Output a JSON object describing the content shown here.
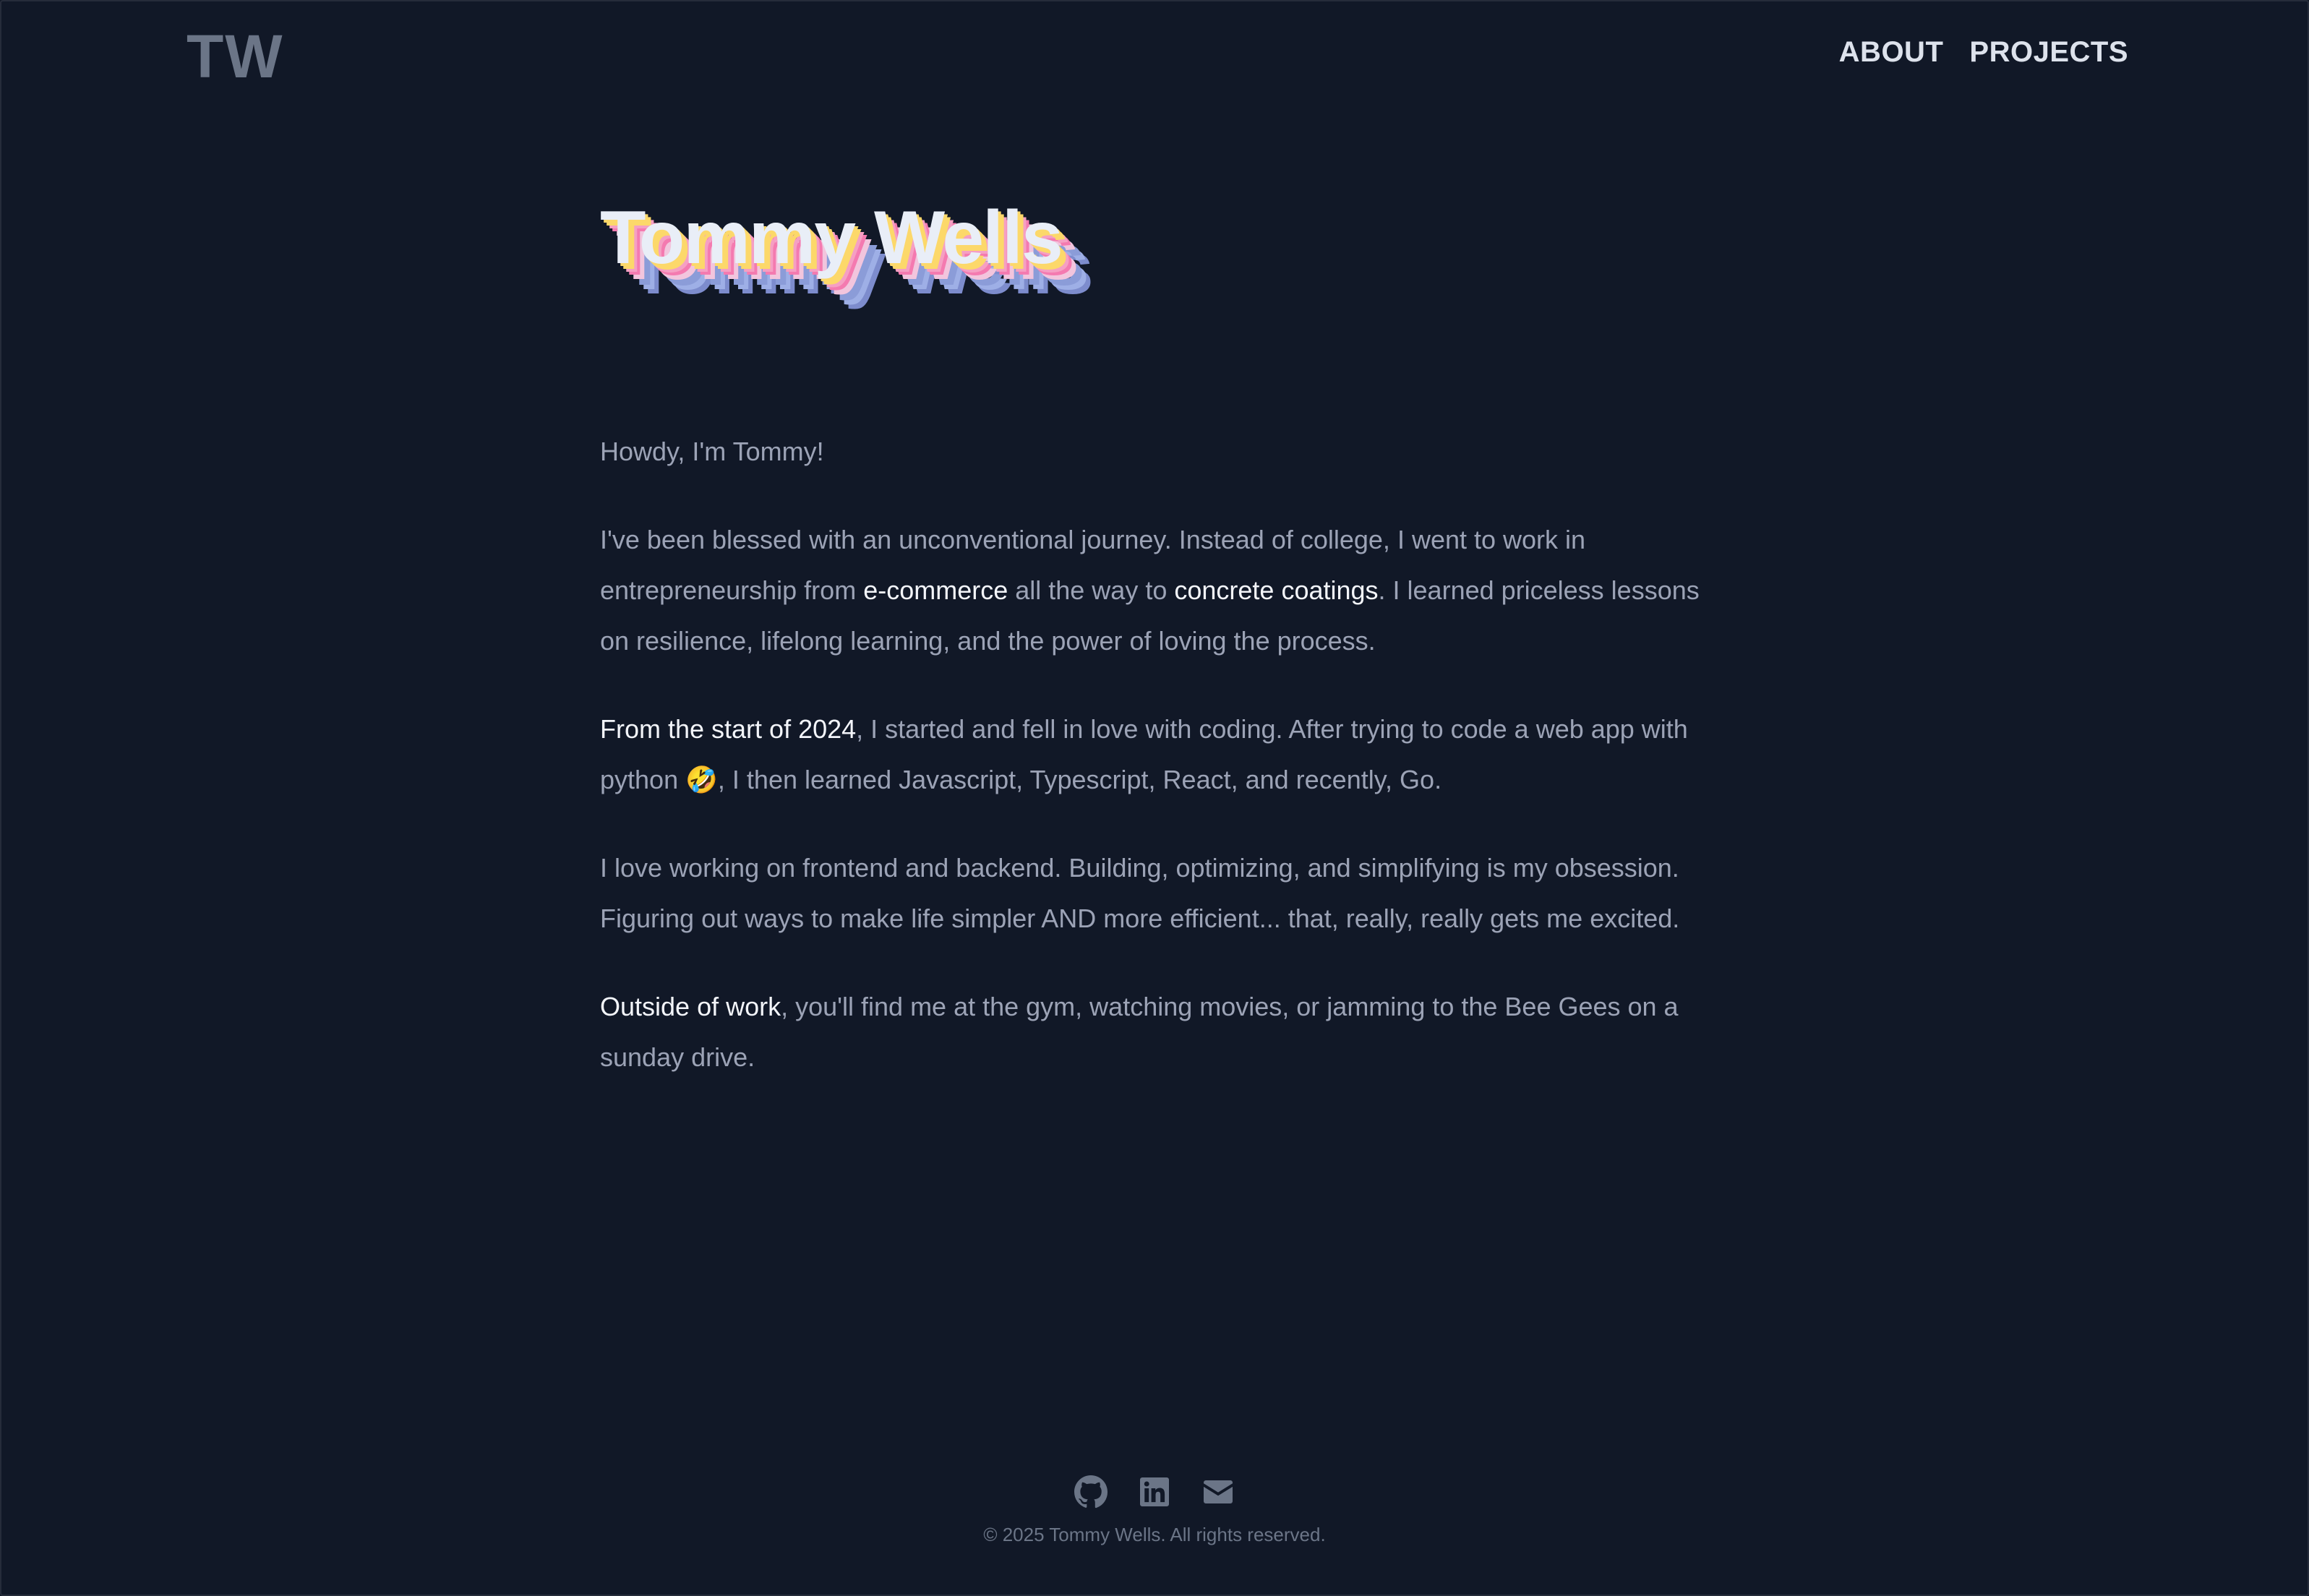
{
  "nav": {
    "logo": "TW",
    "links": [
      "ABOUT",
      "PROJECTS"
    ]
  },
  "hero": {
    "name": "Tommy Wells"
  },
  "about": {
    "greeting": "Howdy, I'm Tommy!",
    "p1_a": "I've been blessed with an unconventional journey. Instead of college, I went to work in entrepreneurship from ",
    "p1_link1": "e-commerce",
    "p1_b": " all the way to ",
    "p1_link2": "concrete coatings",
    "p1_c": ". I learned priceless lessons on resilience, lifelong learning, and the power of loving the process.",
    "p2_link": "From the start of 2024",
    "p2_a": ", I started and fell in love with coding. After trying to code a web app with python ",
    "p2_emoji": "🤣",
    "p2_b": ", I then learned Javascript, Typescript, React, and recently, Go.",
    "p3": "I love working on frontend and backend. Building, optimizing, and simplifying is my obsession. Figuring out ways to make life simpler AND more efficient... that, really, really gets me excited.",
    "p4_link": "Outside of work",
    "p4_a": ", you'll find me at the gym, watching movies, or jamming to the Bee Gees on a sunday drive."
  },
  "footer": {
    "icons": [
      "github-icon",
      "linkedin-icon",
      "mail-icon"
    ],
    "copyright": "© 2025 Tommy Wells. All rights reserved."
  },
  "colors": {
    "background": "#111827",
    "text": "#9ca3b6",
    "highlight": "#f3f5fa",
    "muted": "#6b7587"
  }
}
